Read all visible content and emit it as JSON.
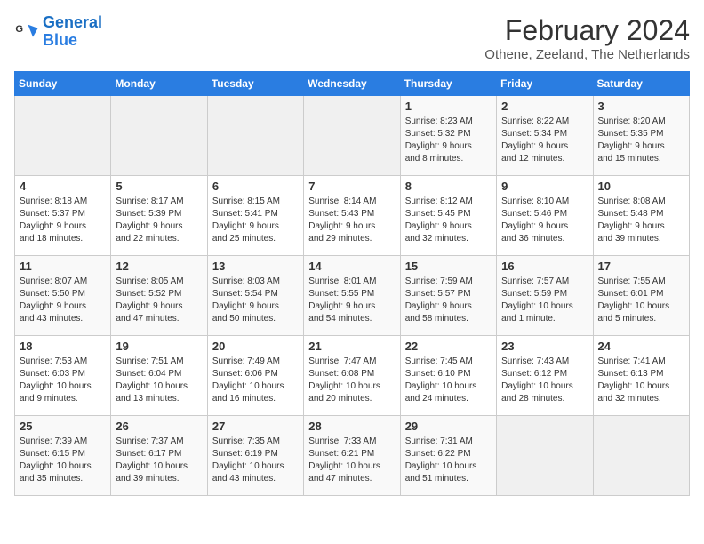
{
  "logo": {
    "line1": "General",
    "line2": "Blue"
  },
  "title": "February 2024",
  "subtitle": "Othene, Zeeland, The Netherlands",
  "weekdays": [
    "Sunday",
    "Monday",
    "Tuesday",
    "Wednesday",
    "Thursday",
    "Friday",
    "Saturday"
  ],
  "weeks": [
    [
      {
        "day": "",
        "content": ""
      },
      {
        "day": "",
        "content": ""
      },
      {
        "day": "",
        "content": ""
      },
      {
        "day": "",
        "content": ""
      },
      {
        "day": "1",
        "content": "Sunrise: 8:23 AM\nSunset: 5:32 PM\nDaylight: 9 hours\nand 8 minutes."
      },
      {
        "day": "2",
        "content": "Sunrise: 8:22 AM\nSunset: 5:34 PM\nDaylight: 9 hours\nand 12 minutes."
      },
      {
        "day": "3",
        "content": "Sunrise: 8:20 AM\nSunset: 5:35 PM\nDaylight: 9 hours\nand 15 minutes."
      }
    ],
    [
      {
        "day": "4",
        "content": "Sunrise: 8:18 AM\nSunset: 5:37 PM\nDaylight: 9 hours\nand 18 minutes."
      },
      {
        "day": "5",
        "content": "Sunrise: 8:17 AM\nSunset: 5:39 PM\nDaylight: 9 hours\nand 22 minutes."
      },
      {
        "day": "6",
        "content": "Sunrise: 8:15 AM\nSunset: 5:41 PM\nDaylight: 9 hours\nand 25 minutes."
      },
      {
        "day": "7",
        "content": "Sunrise: 8:14 AM\nSunset: 5:43 PM\nDaylight: 9 hours\nand 29 minutes."
      },
      {
        "day": "8",
        "content": "Sunrise: 8:12 AM\nSunset: 5:45 PM\nDaylight: 9 hours\nand 32 minutes."
      },
      {
        "day": "9",
        "content": "Sunrise: 8:10 AM\nSunset: 5:46 PM\nDaylight: 9 hours\nand 36 minutes."
      },
      {
        "day": "10",
        "content": "Sunrise: 8:08 AM\nSunset: 5:48 PM\nDaylight: 9 hours\nand 39 minutes."
      }
    ],
    [
      {
        "day": "11",
        "content": "Sunrise: 8:07 AM\nSunset: 5:50 PM\nDaylight: 9 hours\nand 43 minutes."
      },
      {
        "day": "12",
        "content": "Sunrise: 8:05 AM\nSunset: 5:52 PM\nDaylight: 9 hours\nand 47 minutes."
      },
      {
        "day": "13",
        "content": "Sunrise: 8:03 AM\nSunset: 5:54 PM\nDaylight: 9 hours\nand 50 minutes."
      },
      {
        "day": "14",
        "content": "Sunrise: 8:01 AM\nSunset: 5:55 PM\nDaylight: 9 hours\nand 54 minutes."
      },
      {
        "day": "15",
        "content": "Sunrise: 7:59 AM\nSunset: 5:57 PM\nDaylight: 9 hours\nand 58 minutes."
      },
      {
        "day": "16",
        "content": "Sunrise: 7:57 AM\nSunset: 5:59 PM\nDaylight: 10 hours\nand 1 minute."
      },
      {
        "day": "17",
        "content": "Sunrise: 7:55 AM\nSunset: 6:01 PM\nDaylight: 10 hours\nand 5 minutes."
      }
    ],
    [
      {
        "day": "18",
        "content": "Sunrise: 7:53 AM\nSunset: 6:03 PM\nDaylight: 10 hours\nand 9 minutes."
      },
      {
        "day": "19",
        "content": "Sunrise: 7:51 AM\nSunset: 6:04 PM\nDaylight: 10 hours\nand 13 minutes."
      },
      {
        "day": "20",
        "content": "Sunrise: 7:49 AM\nSunset: 6:06 PM\nDaylight: 10 hours\nand 16 minutes."
      },
      {
        "day": "21",
        "content": "Sunrise: 7:47 AM\nSunset: 6:08 PM\nDaylight: 10 hours\nand 20 minutes."
      },
      {
        "day": "22",
        "content": "Sunrise: 7:45 AM\nSunset: 6:10 PM\nDaylight: 10 hours\nand 24 minutes."
      },
      {
        "day": "23",
        "content": "Sunrise: 7:43 AM\nSunset: 6:12 PM\nDaylight: 10 hours\nand 28 minutes."
      },
      {
        "day": "24",
        "content": "Sunrise: 7:41 AM\nSunset: 6:13 PM\nDaylight: 10 hours\nand 32 minutes."
      }
    ],
    [
      {
        "day": "25",
        "content": "Sunrise: 7:39 AM\nSunset: 6:15 PM\nDaylight: 10 hours\nand 35 minutes."
      },
      {
        "day": "26",
        "content": "Sunrise: 7:37 AM\nSunset: 6:17 PM\nDaylight: 10 hours\nand 39 minutes."
      },
      {
        "day": "27",
        "content": "Sunrise: 7:35 AM\nSunset: 6:19 PM\nDaylight: 10 hours\nand 43 minutes."
      },
      {
        "day": "28",
        "content": "Sunrise: 7:33 AM\nSunset: 6:21 PM\nDaylight: 10 hours\nand 47 minutes."
      },
      {
        "day": "29",
        "content": "Sunrise: 7:31 AM\nSunset: 6:22 PM\nDaylight: 10 hours\nand 51 minutes."
      },
      {
        "day": "",
        "content": ""
      },
      {
        "day": "",
        "content": ""
      }
    ]
  ]
}
